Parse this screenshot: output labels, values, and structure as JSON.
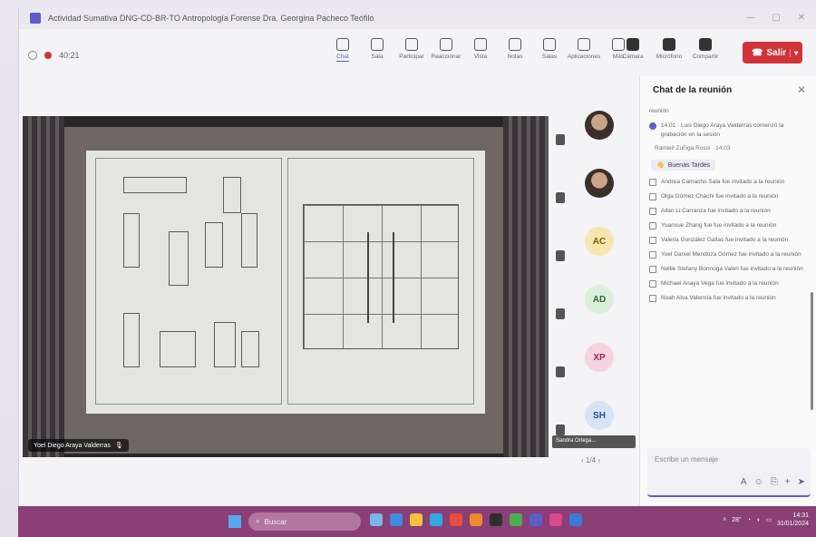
{
  "window": {
    "title": "Actividad Sumativa DNG-CD-BR-TO Antropología Forense Dra. Georgina Pacheco Teófilo",
    "controls": [
      "—",
      "▢",
      "✕"
    ]
  },
  "toolbar": {
    "timer": "40:21",
    "tools": [
      {
        "label": "Chat",
        "icon": "chat-icon",
        "active": true
      },
      {
        "label": "Sala",
        "icon": "people-icon"
      },
      {
        "label": "Participar",
        "icon": "raise-hand-icon"
      },
      {
        "label": "Reaccionar",
        "icon": "reaction-icon"
      },
      {
        "label": "Vista",
        "icon": "view-icon"
      },
      {
        "label": "Notas",
        "icon": "notes-icon"
      },
      {
        "label": "Salas",
        "icon": "rooms-icon"
      },
      {
        "label": "Aplicaciones",
        "icon": "apps-icon"
      },
      {
        "label": "Más",
        "icon": "more-icon"
      }
    ],
    "media": [
      {
        "label": "Cámara",
        "icon": "camera-icon"
      },
      {
        "label": "Micrófono",
        "icon": "microphone-icon"
      },
      {
        "label": "Compartir",
        "icon": "share-icon"
      }
    ],
    "leave_label": "Salir"
  },
  "stage": {
    "presenter_name": "Yoel Diego Araya Valderras"
  },
  "participants": [
    {
      "initials": "",
      "photo": true
    },
    {
      "initials": "",
      "photo": true
    },
    {
      "initials": "AC",
      "color": "#f6e7b0",
      "text_color": "#7a5b00"
    },
    {
      "initials": "AD",
      "color": "#dcefdc",
      "text_color": "#2e6b2e"
    },
    {
      "initials": "XP",
      "color": "#f6d4df",
      "text_color": "#9b2451"
    },
    {
      "initials": "SH",
      "color": "#d7e3f6",
      "text_color": "#28508f"
    }
  ],
  "self_tag": "Sandra Ortega...",
  "pager": "1/4",
  "chat": {
    "title": "Chat de la reunión",
    "messages_top": [
      {
        "text": "reunión",
        "type": "plain"
      },
      {
        "text": "14:01 · Luis Diego Araya Valderras comenzó la grabación en la sesión",
        "type": "dot"
      }
    ],
    "sender": "Ramiell Zuñiga Rossi · 14:03",
    "reaction_label": "Buenas Tardes",
    "messages": [
      "Andrea Camacho Sala fue invitado a la reunión",
      "Olga Gómez Cháchi fue invitado a la reunión",
      "Allan Li Carranza fue invitado a la reunión",
      "Yuanxue Zhang fue fue invitado a la reunión",
      "Valeria González Gallas fue invitado a la reunión",
      "Yoel Daniel Mendoza Gómez fue invitado a la reunión",
      "Nellie Stefany Bonnoga Valeri fue invitado a la reunión",
      "Michael Anaya Vega fue invitado a la reunión",
      "Noah Alva Valencia fue invitado a la reunión"
    ],
    "compose_placeholder": "Escribe un mensaje"
  },
  "taskbar": {
    "search_placeholder": "Buscar",
    "time": "14:31",
    "date": "31/01/2024",
    "weather": "28°"
  }
}
